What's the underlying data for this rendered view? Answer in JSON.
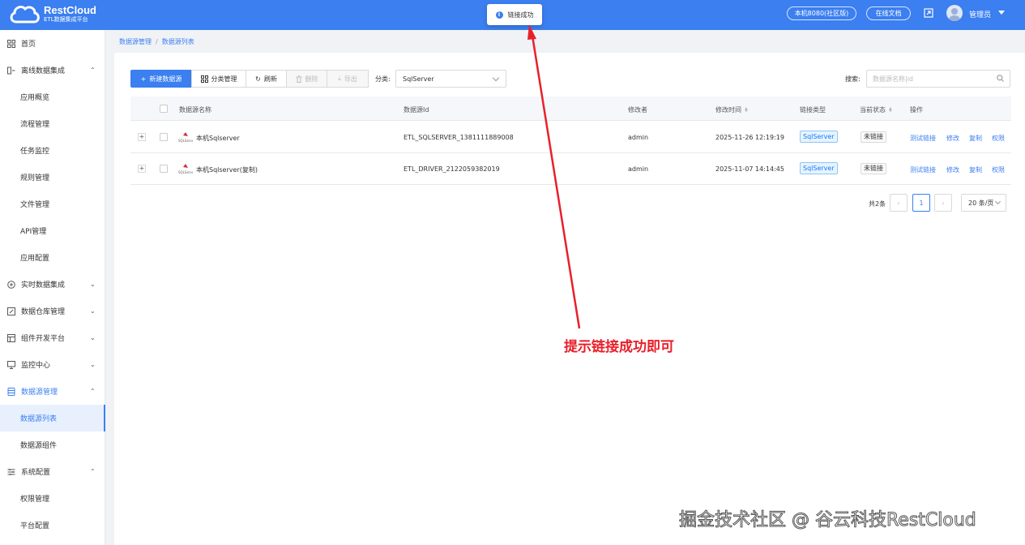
{
  "app": {
    "brand_name": "RestCloud",
    "brand_sub": "ETL数据集成平台"
  },
  "toast": {
    "text": "链接成功",
    "icon": "info-icon"
  },
  "header": {
    "env_button": "本机8080(社区版)",
    "docs_button": "在线文档",
    "user_name": "管理员"
  },
  "sidebar": {
    "items": [
      {
        "label": "首页",
        "icon": "home-icon",
        "type": "top"
      },
      {
        "label": "离线数据集成",
        "icon": "integration-icon",
        "type": "group",
        "chevron": "up"
      },
      {
        "label": "应用概览",
        "type": "sub"
      },
      {
        "label": "流程管理",
        "type": "sub"
      },
      {
        "label": "任务监控",
        "type": "sub"
      },
      {
        "label": "规则管理",
        "type": "sub"
      },
      {
        "label": "文件管理",
        "type": "sub"
      },
      {
        "label": "API管理",
        "type": "sub"
      },
      {
        "label": "应用配置",
        "type": "sub"
      },
      {
        "label": "实时数据集成",
        "icon": "realtime-icon",
        "type": "group",
        "chevron": "down"
      },
      {
        "label": "数据仓库管理",
        "icon": "warehouse-icon",
        "type": "group",
        "chevron": "down"
      },
      {
        "label": "组件开发平台",
        "icon": "component-icon",
        "type": "group",
        "chevron": "down"
      },
      {
        "label": "监控中心",
        "icon": "monitor-icon",
        "type": "group",
        "chevron": "down"
      },
      {
        "label": "数据源管理",
        "icon": "datasource-icon",
        "type": "group",
        "chevron": "up"
      },
      {
        "label": "数据源列表",
        "type": "sub",
        "active": true
      },
      {
        "label": "数据源组件",
        "type": "sub"
      },
      {
        "label": "系统配置",
        "icon": "settings-icon",
        "type": "group",
        "chevron": "up"
      },
      {
        "label": "权限管理",
        "type": "sub"
      },
      {
        "label": "平台配置",
        "type": "sub"
      }
    ]
  },
  "breadcrumb": {
    "parent": "数据源管理",
    "sep": "/",
    "current": "数据源列表"
  },
  "toolbar": {
    "new_label": "新建数据源",
    "category_manage_label": "分类管理",
    "refresh_label": "刷新",
    "delete_label": "删除",
    "export_label": "导出",
    "category_label": "分类:",
    "category_value": "SqlServer",
    "search_label": "搜索:",
    "search_placeholder": "数据源名称|id"
  },
  "table": {
    "columns": [
      "数据源名称",
      "数据源Id",
      "修改者",
      "修改时间",
      "链接类型",
      "当前状态",
      "操作"
    ],
    "rows": [
      {
        "name": "本机Sqlserver",
        "id": "ETL_SQLSERVER_1381111889008",
        "editor": "admin",
        "modified": "2025-11-26 12:19:19",
        "type": "SqlServer",
        "status": "未链接",
        "actions": [
          "测试链接",
          "修改",
          "复制",
          "权限"
        ]
      },
      {
        "name": "本机Sqlserver(复制)",
        "id": "ETL_DRIVER_2122059382019",
        "editor": "admin",
        "modified": "2025-11-07 14:14:45",
        "type": "SqlServer",
        "status": "未链接",
        "actions": [
          "测试链接",
          "修改",
          "复制",
          "权限"
        ]
      }
    ]
  },
  "pagination": {
    "total": "共2条",
    "current_page": "1",
    "page_size": "20 条/页"
  },
  "annotation": {
    "text": "提示链接成功即可",
    "color": "#e8202a"
  },
  "watermark": "掘金技术社区 @ 谷云科技RestCloud",
  "colors": {
    "primary": "#3b7ff0",
    "annotation": "#e8202a"
  }
}
